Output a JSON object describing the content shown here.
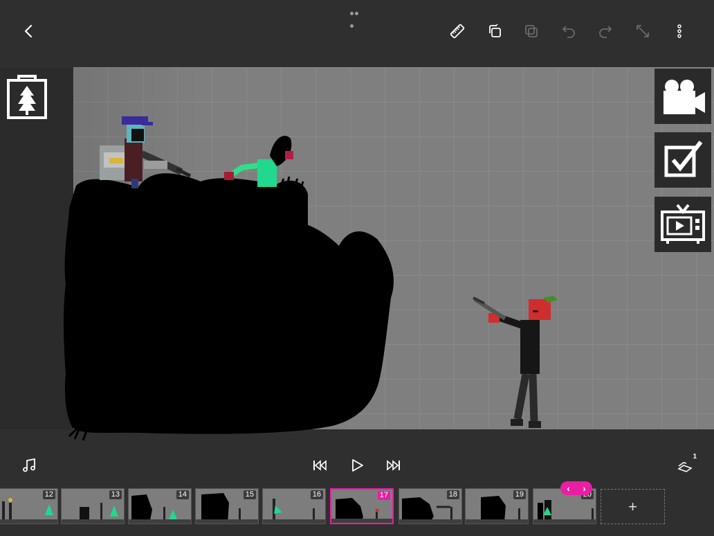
{
  "toolbar": {
    "back": "back-arrow-icon",
    "ruler": "ruler-icon",
    "duplicate": "duplicate-icon",
    "copy": "copy-icon",
    "undo": "undo-icon",
    "redo": "redo-icon",
    "resize": "resize-icon",
    "more": "more-vertical-icon"
  },
  "side_tools": [
    "camera-icon",
    "checkbox-icon",
    "tv-play-icon"
  ],
  "playback": {
    "music": "music-note-icon",
    "skip_start": "skip-to-start-icon",
    "play": "play-icon",
    "skip_end": "skip-to-end-icon",
    "onion_skin": "1"
  },
  "timeline": {
    "frames": [
      {
        "number": "12",
        "active": false
      },
      {
        "number": "13",
        "active": false
      },
      {
        "number": "14",
        "active": false
      },
      {
        "number": "15",
        "active": false
      },
      {
        "number": "16",
        "active": false
      },
      {
        "number": "17",
        "active": true
      },
      {
        "number": "18",
        "active": false
      },
      {
        "number": "19",
        "active": false
      },
      {
        "number": "20",
        "active": false
      }
    ],
    "add_label": "+",
    "nav_prev": "‹",
    "nav_next": "›"
  },
  "colors": {
    "accent": "#e91ea5",
    "background": "#2f2f2f",
    "stage": "#7f7f7f"
  }
}
